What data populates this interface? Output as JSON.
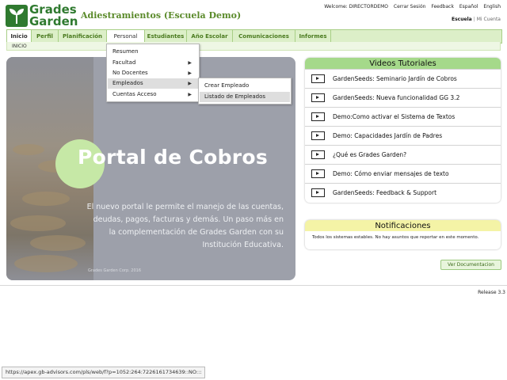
{
  "brand": {
    "line1": "Grades",
    "line2": "Garden",
    "app_title": "Adiestramientos (Escuela Demo)"
  },
  "top_links": {
    "welcome": "Welcome: DIRECTORDEMO",
    "logout": "Cerrar Sesión",
    "feedback": "Feedback",
    "spanish": "Español",
    "english": "English"
  },
  "scope": {
    "school": "Escuela",
    "separator": "|",
    "account": "Mi Cuenta"
  },
  "nav": {
    "tabs": [
      "Inicio",
      "Perfil",
      "Planificación",
      "Personal",
      "Estudiantes",
      "Año Escolar",
      "Comunicaciones",
      "Informes"
    ],
    "breadcrumb": "INICIO"
  },
  "personal_menu": [
    "Resumen",
    "Facultad",
    "No Docentes",
    "Empleados",
    "Cuentas Acceso"
  ],
  "empleados_submenu": [
    "Crear Empleado",
    "Listado de Empleados"
  ],
  "banner": {
    "title": "Portal de Cobros",
    "text": "El nuevo portal le permite el manejo de las cuentas, deudas, pagos, facturas y demás. Un paso más en la complementación de Grades Garden con su Institución Educativa.",
    "copyright": "Grades Garden Corp. 2016"
  },
  "videos": {
    "title": "Videos Tutoriales",
    "items": [
      "GardenSeeds: Seminario Jardín de Cobros",
      "GardenSeeds: Nueva funcionalidad GG 3.2",
      "Demo:Como activar el Sistema de Textos",
      "Demo: Capacidades Jardín de Padres",
      "¿Qué es Grades Garden?",
      "Demo: Cómo enviar mensajes de texto",
      "GardenSeeds: Feedback & Support"
    ]
  },
  "notifications": {
    "title": "Notificaciones",
    "text": "Todos los sistemas estables. No hay asuntos que reportar en este momento."
  },
  "doc_button": "Ver Documentacion",
  "release": "Release 3.3",
  "status_url": "https://apex.gb-advisors.com/pls/web/f?p=1052:264:7226161734639::NO:::",
  "colors": {
    "brand_green": "#2f7a2f",
    "nav_bg": "#dcefc8",
    "video_header": "#a5d98a",
    "notif_header": "#f4f3a6",
    "menu_highlight": "#dedede"
  }
}
